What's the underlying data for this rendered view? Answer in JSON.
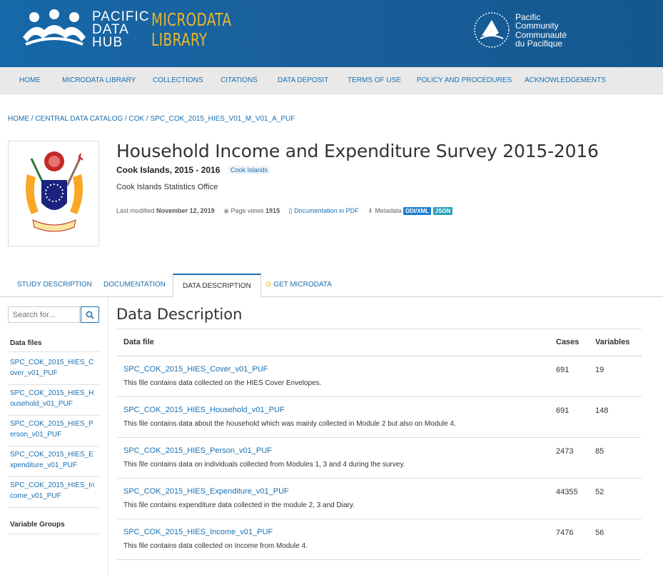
{
  "header": {
    "pdh_lines": [
      "PACIFIC",
      "DATA",
      "HUB"
    ],
    "ml_lines": [
      "MICRODATA",
      "LIBRARY"
    ],
    "pc_lines": [
      "Pacific",
      "Community",
      "Communauté",
      "du Pacifique"
    ],
    "colors": {
      "header_bg": "#1668a8",
      "accent_gold": "#e8b82a"
    }
  },
  "nav": {
    "items": [
      "HOME",
      "MICRODATA LIBRARY",
      "COLLECTIONS",
      "CITATIONS",
      "DATA DEPOSIT",
      "TERMS OF USE",
      "POLICY AND PROCEDURES",
      "ACKNOWLEDGEMENTS"
    ]
  },
  "breadcrumb": "HOME / CENTRAL DATA CATALOG / COK / SPC_COK_2015_HIES_V01_M_V01_A_PUF",
  "study": {
    "title": "Household Income and Expenditure Survey 2015-2016",
    "subtitle": "Cook Islands, 2015 - 2016",
    "country_badge": "Cook Islands",
    "agency": "Cook Islands Statistics Office",
    "last_modified_label": "Last modified",
    "last_modified": "November 12, 2019",
    "page_views_label": "Page views",
    "page_views": "1915",
    "documentation_pdf": "Documentation in PDF",
    "metadata_label": "Metadata",
    "badge_ddi": "DDI/XML",
    "badge_json": "JSON"
  },
  "tabs": [
    "STUDY DESCRIPTION",
    "DOCUMENTATION",
    "DATA DESCRIPTION",
    "GET MICRODATA"
  ],
  "sidebar": {
    "search_placeholder": "Search for...",
    "data_files_heading": "Data files",
    "data_files": [
      "SPC_COK_2015_HIES_Cover_v01_PUF",
      "SPC_COK_2015_HIES_Household_v01_PUF",
      "SPC_COK_2015_HIES_Person_v01_PUF",
      "SPC_COK_2015_HIES_Expenditure_v01_PUF",
      "SPC_COK_2015_HIES_Income_v01_PUF"
    ],
    "variable_groups_heading": "Variable Groups"
  },
  "main": {
    "section_title": "Data Description",
    "columns": {
      "file": "Data file",
      "cases": "Cases",
      "variables": "Variables"
    },
    "rows": [
      {
        "name": "SPC_COK_2015_HIES_Cover_v01_PUF",
        "desc": "This file contains data collected on the HIES Cover Envelopes.",
        "cases": "691",
        "variables": "19"
      },
      {
        "name": "SPC_COK_2015_HIES_Household_v01_PUF",
        "desc": "This file contains data about the household which was mainly collected in Module 2 but also on Module 4.",
        "cases": "691",
        "variables": "148"
      },
      {
        "name": "SPC_COK_2015_HIES_Person_v01_PUF",
        "desc": "This file contains data on individuals collected from Modules 1, 3 and 4 during the survey.",
        "cases": "2473",
        "variables": "85"
      },
      {
        "name": "SPC_COK_2015_HIES_Expenditure_v01_PUF",
        "desc": "This file contains expenditure data collected in the module 2, 3 and Diary.",
        "cases": "44355",
        "variables": "52"
      },
      {
        "name": "SPC_COK_2015_HIES_Income_v01_PUF",
        "desc": "This file contains data collected on Income from Module 4.",
        "cases": "7476",
        "variables": "56"
      }
    ]
  }
}
